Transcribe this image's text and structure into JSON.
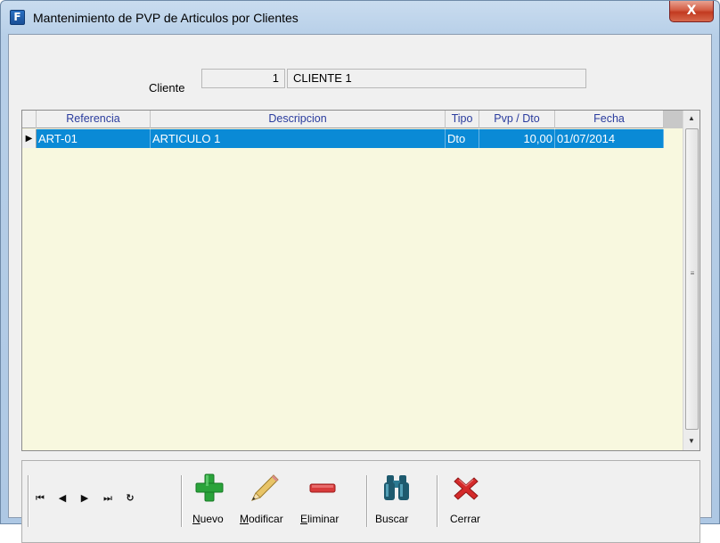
{
  "window": {
    "title": "Mantenimiento de PVP de Articulos por Clientes",
    "app_icon_glyph": "F",
    "close_glyph": "X"
  },
  "cliente": {
    "label": "Cliente",
    "code": "1",
    "name": "CLIENTE 1"
  },
  "grid": {
    "columns": [
      "Referencia",
      "Descripcion",
      "Tipo",
      "Pvp / Dto",
      "Fecha"
    ],
    "rows": [
      {
        "referencia": "ART-01",
        "descripcion": "ARTICULO 1",
        "tipo": "Dto",
        "pvp_dto": "10,00",
        "fecha": "01/07/2014",
        "selected": true
      }
    ],
    "row_indicator": "▶",
    "selection_color": "#0a8ad6",
    "background_color": "#f8f8df",
    "header_text_color": "#2a3c9e"
  },
  "scrollbar": {
    "up_glyph": "▲",
    "down_glyph": "▼",
    "grip_glyph": "≡"
  },
  "toolbar": {
    "nav": {
      "first": "⏮",
      "prev": "◀",
      "next": "▶",
      "last": "⏭",
      "refresh": "↻"
    },
    "buttons": [
      {
        "name": "nuevo",
        "label_underlined": "N",
        "label_rest": "uevo",
        "icon": "plus-icon",
        "color": "#2aa33a"
      },
      {
        "name": "modificar",
        "label_underlined": "M",
        "label_rest": "odificar",
        "icon": "pencil-icon",
        "color": "#d9b24a"
      },
      {
        "name": "eliminar",
        "label_underlined": "E",
        "label_rest": "liminar",
        "icon": "minus-icon",
        "color": "#d83a3a"
      },
      {
        "name": "buscar",
        "label": "Buscar",
        "icon": "binoculars-icon",
        "color": "#1e5a6e"
      },
      {
        "name": "cerrar",
        "label": "Cerrar",
        "icon": "close-x-icon",
        "color": "#d42a2a"
      }
    ]
  }
}
